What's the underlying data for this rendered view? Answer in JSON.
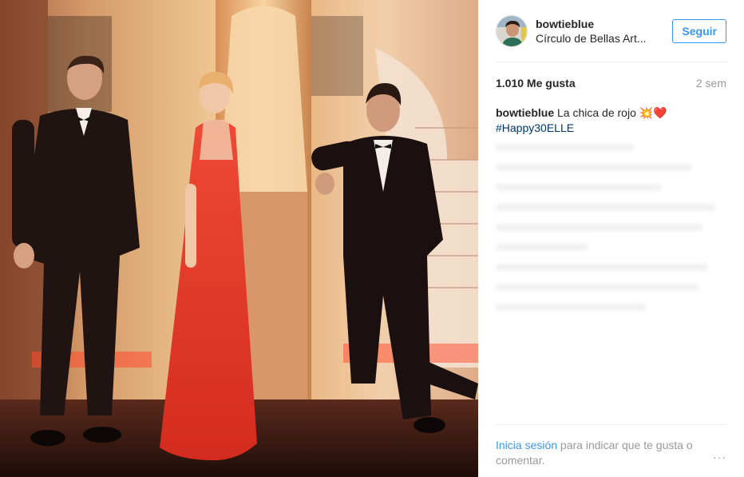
{
  "post": {
    "photo_alt": "",
    "header": {
      "username": "bowtieblue",
      "location": "Círculo de Bellas Art...",
      "follow_label": "Seguir"
    },
    "stats": {
      "likes": "1.010 Me gusta",
      "time_ago": "2 sem"
    },
    "caption": {
      "username": "bowtieblue",
      "text": "La chica de rojo 💥❤️",
      "hashtag": "#Happy30ELLE"
    },
    "footer": {
      "login_link": "Inicia sesión",
      "login_text": " para indicar que te gusta o comentar.",
      "more_icon": "···"
    }
  },
  "colors": {
    "accent": "#3897f0",
    "hashtag": "#003569",
    "muted": "#999999",
    "dress": "#e03a2b"
  }
}
